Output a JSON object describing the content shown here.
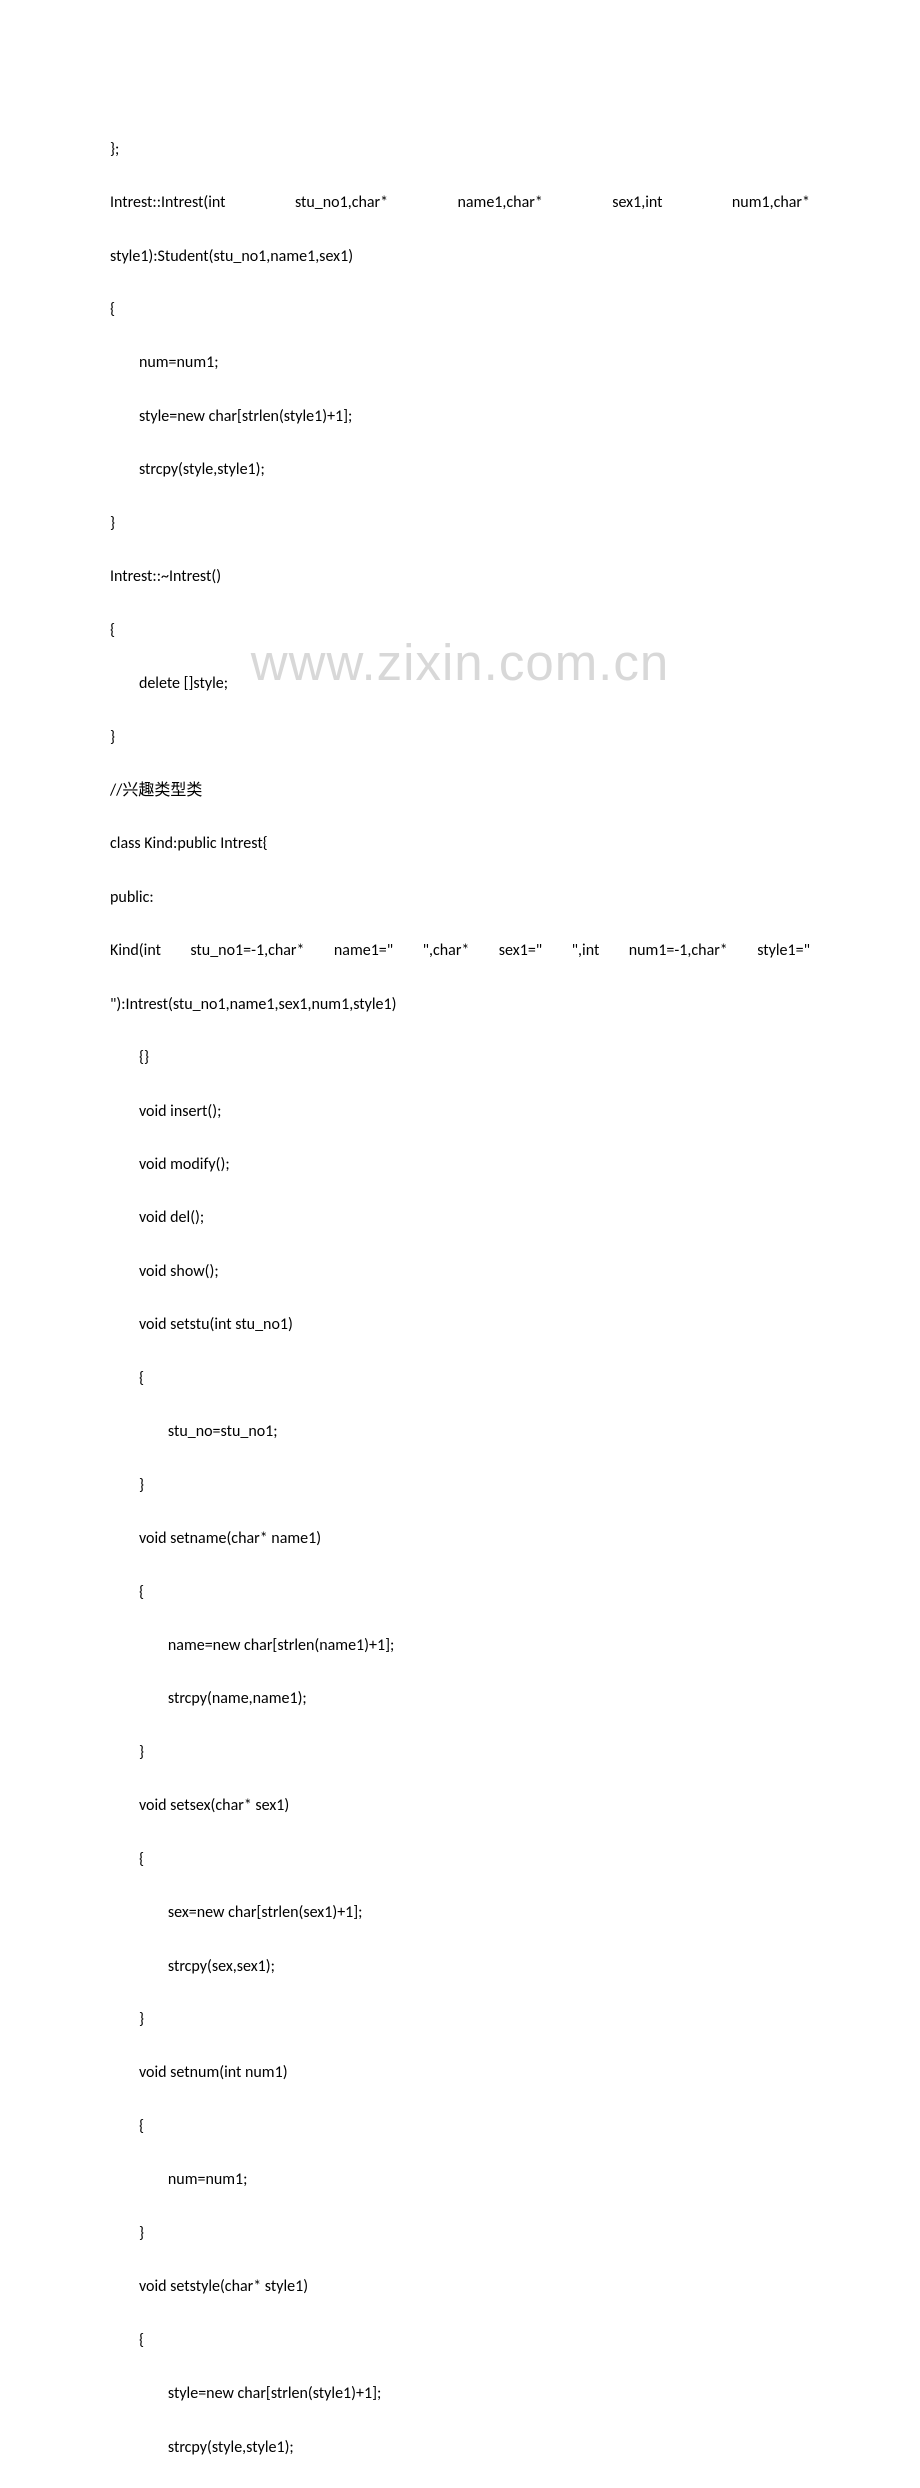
{
  "watermark": "www.zixin.com.cn",
  "code": {
    "l01": "};",
    "l02_parts": [
      "Intrest::Intrest(int",
      "stu_no1,char*",
      "name1,char*",
      "sex1,int",
      "num1,char*"
    ],
    "l03": "style1):Student(stu_no1,name1,sex1)",
    "l04": "{",
    "l05": "        num=num1;",
    "l06": "        style=new char[strlen(style1)+1];",
    "l07": "        strcpy(style,style1);",
    "l08": "}",
    "l09": "Intrest::~Intrest()",
    "l10": "{",
    "l11": "        delete []style;",
    "l12": "}",
    "l13": "//兴趣类型类",
    "l14": "class Kind:public Intrest{",
    "l15": "public:",
    "l16_parts": [
      "        Kind(int",
      "stu_no1=-1,char*",
      "name1=\"",
      "\",char*",
      "sex1=\"",
      "\",int",
      "num1=-1,char*",
      "style1=\""
    ],
    "l17": "\"):Intrest(stu_no1,name1,sex1,num1,style1)",
    "l18": "        {}",
    "l19": "        void insert();",
    "l20": "        void modify();",
    "l21": "        void del();",
    "l22": "        void show();",
    "l23": "        void setstu(int stu_no1)",
    "l24": "        {",
    "l25": "                stu_no=stu_no1;",
    "l26": "        }",
    "l27": "        void setname(char* name1)",
    "l28": "        {",
    "l29": "                name=new char[strlen(name1)+1];",
    "l30": "                strcpy(name,name1);",
    "l31": "        }",
    "l32": "        void setsex(char* sex1)",
    "l33": "        {",
    "l34": "                sex=new char[strlen(sex1)+1];",
    "l35": "                strcpy(sex,sex1);",
    "l36": "        }",
    "l37": "        void setnum(int num1)",
    "l38": "        {",
    "l39": "                num=num1;",
    "l40": "        }",
    "l41": "        void setstyle(char* style1)",
    "l42": "        {",
    "l43": "                style=new char[strlen(style1)+1];",
    "l44": "                strcpy(style,style1);"
  }
}
